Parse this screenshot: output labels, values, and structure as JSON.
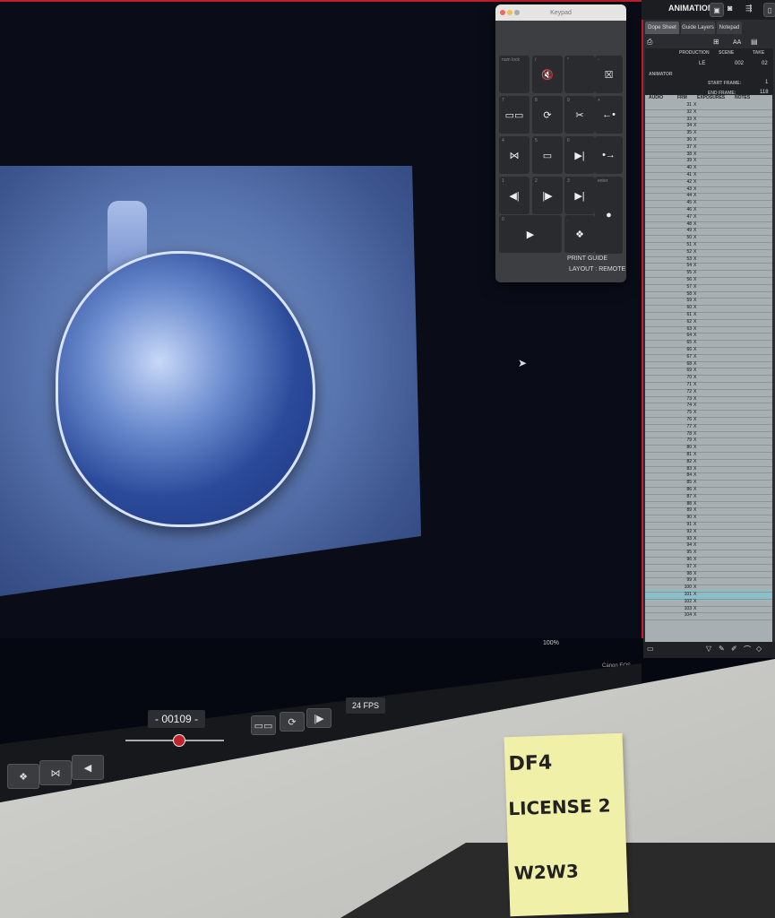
{
  "app": {
    "title": "ANIMATION"
  },
  "keypad": {
    "title": "Keypad",
    "keys": [
      {
        "sub": "num lock",
        "icon": ""
      },
      {
        "sub": "/",
        "icon": "🔇"
      },
      {
        "sub": "*",
        "icon": ""
      },
      {
        "sub": "-",
        "icon": "☒"
      },
      {
        "sub": "7",
        "icon": "▭▭"
      },
      {
        "sub": "8",
        "icon": "⟳"
      },
      {
        "sub": "9",
        "icon": "✂"
      },
      {
        "sub": "+",
        "icon": "←•"
      },
      {
        "sub": "4",
        "icon": "⋈"
      },
      {
        "sub": "5",
        "icon": "▭"
      },
      {
        "sub": "6",
        "icon": "▶|"
      },
      {
        "sub": "",
        "icon": "•→"
      },
      {
        "sub": "1",
        "icon": "◀|"
      },
      {
        "sub": "2",
        "icon": "|▶"
      },
      {
        "sub": "3",
        "icon": "▶|"
      },
      {
        "sub": "enter",
        "icon": "●"
      },
      {
        "sub": "0",
        "icon": "▶"
      },
      {
        "sub": ".",
        "icon": "❖"
      }
    ],
    "print_guide": "PRINT GUIDE",
    "layout": "LAYOUT : REMOTE"
  },
  "viewer": {
    "zoom": "100%",
    "camera": "Canon EOS 700D"
  },
  "transport": {
    "frame_counter": "- 00109 -",
    "fps": "24 FPS"
  },
  "dope_sheet": {
    "tabs": [
      "Dope Sheet",
      "Guide Layers",
      "Notepad"
    ],
    "labels": {
      "production": "PRODUCTION",
      "scene": "SCENE",
      "take": "TAKE",
      "animator": "ANIMATOR",
      "start_frame": "START FRAME:",
      "end_frame": "END FRAME:"
    },
    "values": {
      "production": "LE",
      "scene": "002",
      "take": "02",
      "start_frame": "1",
      "end_frame": "118"
    },
    "columns": [
      "AUDIO",
      "FRM",
      "EXPOSURES",
      "NOTES"
    ],
    "rows": [
      "31",
      "32",
      "33",
      "34",
      "35",
      "36",
      "37",
      "38",
      "39",
      "40",
      "41",
      "42",
      "43",
      "44",
      "45",
      "46",
      "47",
      "48",
      "49",
      "50",
      "51",
      "52",
      "53",
      "54",
      "55",
      "56",
      "57",
      "58",
      "59",
      "60",
      "61",
      "62",
      "63",
      "64",
      "65",
      "66",
      "67",
      "68",
      "69",
      "70",
      "71",
      "72",
      "73",
      "74",
      "75",
      "76",
      "77",
      "78",
      "79",
      "80",
      "81",
      "82",
      "83",
      "84",
      "85",
      "86",
      "87",
      "88",
      "89",
      "90",
      "91",
      "92",
      "93",
      "94",
      "95",
      "96",
      "97",
      "98",
      "99",
      "100",
      "101",
      "102",
      "103",
      "104"
    ],
    "exposure_mark": "X"
  },
  "sticky_note": {
    "line1": "DF4",
    "line2": "LICENSE 2",
    "line3": "W2W3"
  },
  "colors": {
    "accent_red": "#c21d2b",
    "highlight_row": "#7fc5d0",
    "sticky": "#f1f0a8"
  }
}
